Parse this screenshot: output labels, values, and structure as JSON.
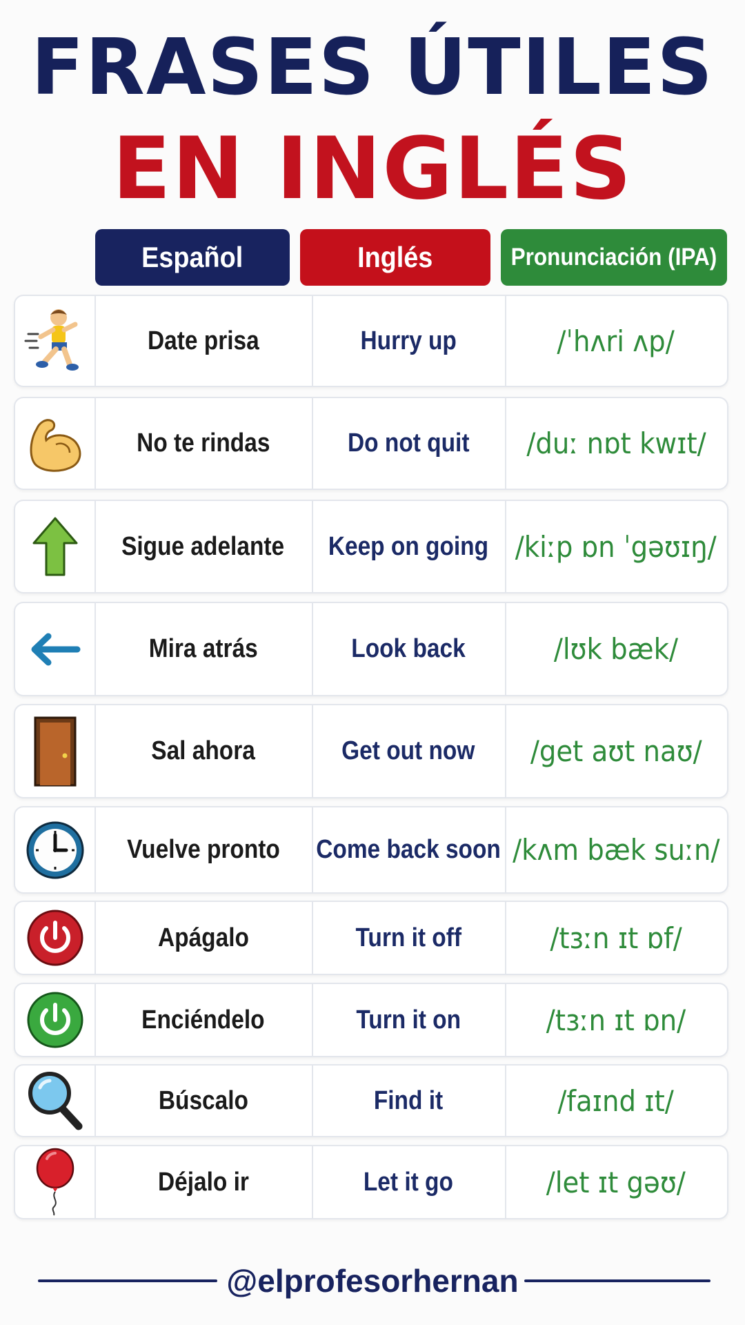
{
  "title": {
    "line1": "FRASES ÚTILES",
    "line2": "EN INGLÉS"
  },
  "headers": {
    "spanish": "Español",
    "english": "Inglés",
    "ipa": "Pronunciación (IPA)"
  },
  "colors": {
    "navy": "#18235f",
    "red": "#c4101b",
    "green": "#2e8b3a"
  },
  "rows": [
    {
      "icon": "running-boy-icon",
      "es": "Date prisa",
      "en": "Hurry up",
      "ipa": "/ˈhʌri ʌp/"
    },
    {
      "icon": "flexed-bicep-icon",
      "es": "No te rindas",
      "en": "Do not quit",
      "ipa": "/duː nɒt kwɪt/"
    },
    {
      "icon": "arrow-up-icon",
      "es": "Sigue adelante",
      "en": "Keep on going",
      "ipa": "/kiːp ɒn ˈgəʊɪŋ/"
    },
    {
      "icon": "arrow-left-icon",
      "es": "Mira atrás",
      "en": "Look back",
      "ipa": "/lʊk bæk/"
    },
    {
      "icon": "door-icon",
      "es": "Sal ahora",
      "en": "Get out now",
      "ipa": "/get aʊt naʊ/"
    },
    {
      "icon": "clock-icon",
      "es": "Vuelve pronto",
      "en": "Come back soon",
      "ipa": "/kʌm bæk suːn/"
    },
    {
      "icon": "power-off-icon",
      "es": "Apágalo",
      "en": "Turn it off",
      "ipa": "/tɜːn ɪt ɒf/"
    },
    {
      "icon": "power-on-icon",
      "es": "Enciéndelo",
      "en": "Turn it on",
      "ipa": "/tɜːn ɪt ɒn/"
    },
    {
      "icon": "magnifier-icon",
      "es": "Búscalo",
      "en": "Find it",
      "ipa": "/faɪnd ɪt/"
    },
    {
      "icon": "balloon-icon",
      "es": "Déjalo ir",
      "en": "Let it go",
      "ipa": "/let ɪt gəʊ/"
    }
  ],
  "footer": {
    "handle": "@elprofesorhernan"
  }
}
